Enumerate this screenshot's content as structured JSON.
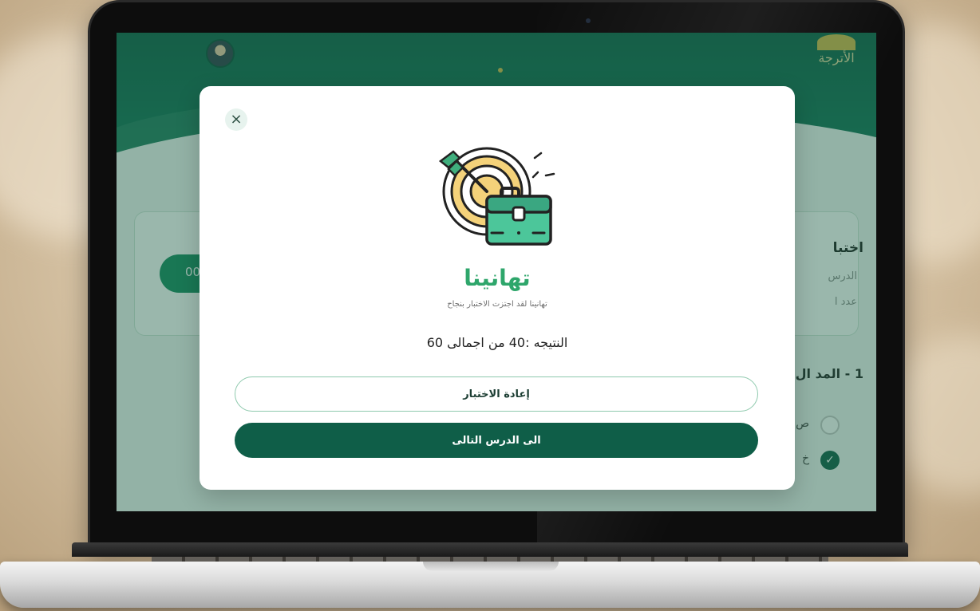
{
  "modal": {
    "close_icon": "×",
    "title": "تهانينا",
    "subtitle": "تهانينا لقد اجتزت الاختبار بنجاح",
    "score_text": "النتيجه :40 من اجمالى 60",
    "retry_label": "إعادة الاختبار",
    "next_label": "الى الدرس التالى",
    "illustration": "target-briefcase-icon"
  },
  "background": {
    "pill_text": "00",
    "card_title": "اختبا",
    "card_sub1": "الدرس",
    "card_sub2": "عدد ا",
    "question": "1 - المد ال",
    "option_a": "ص",
    "option_b": "خ",
    "logo_text": "الأترجة"
  },
  "colors": {
    "brand_green": "#0f5e48",
    "accent_green": "#2ea66b",
    "gold": "#d6b64a"
  }
}
